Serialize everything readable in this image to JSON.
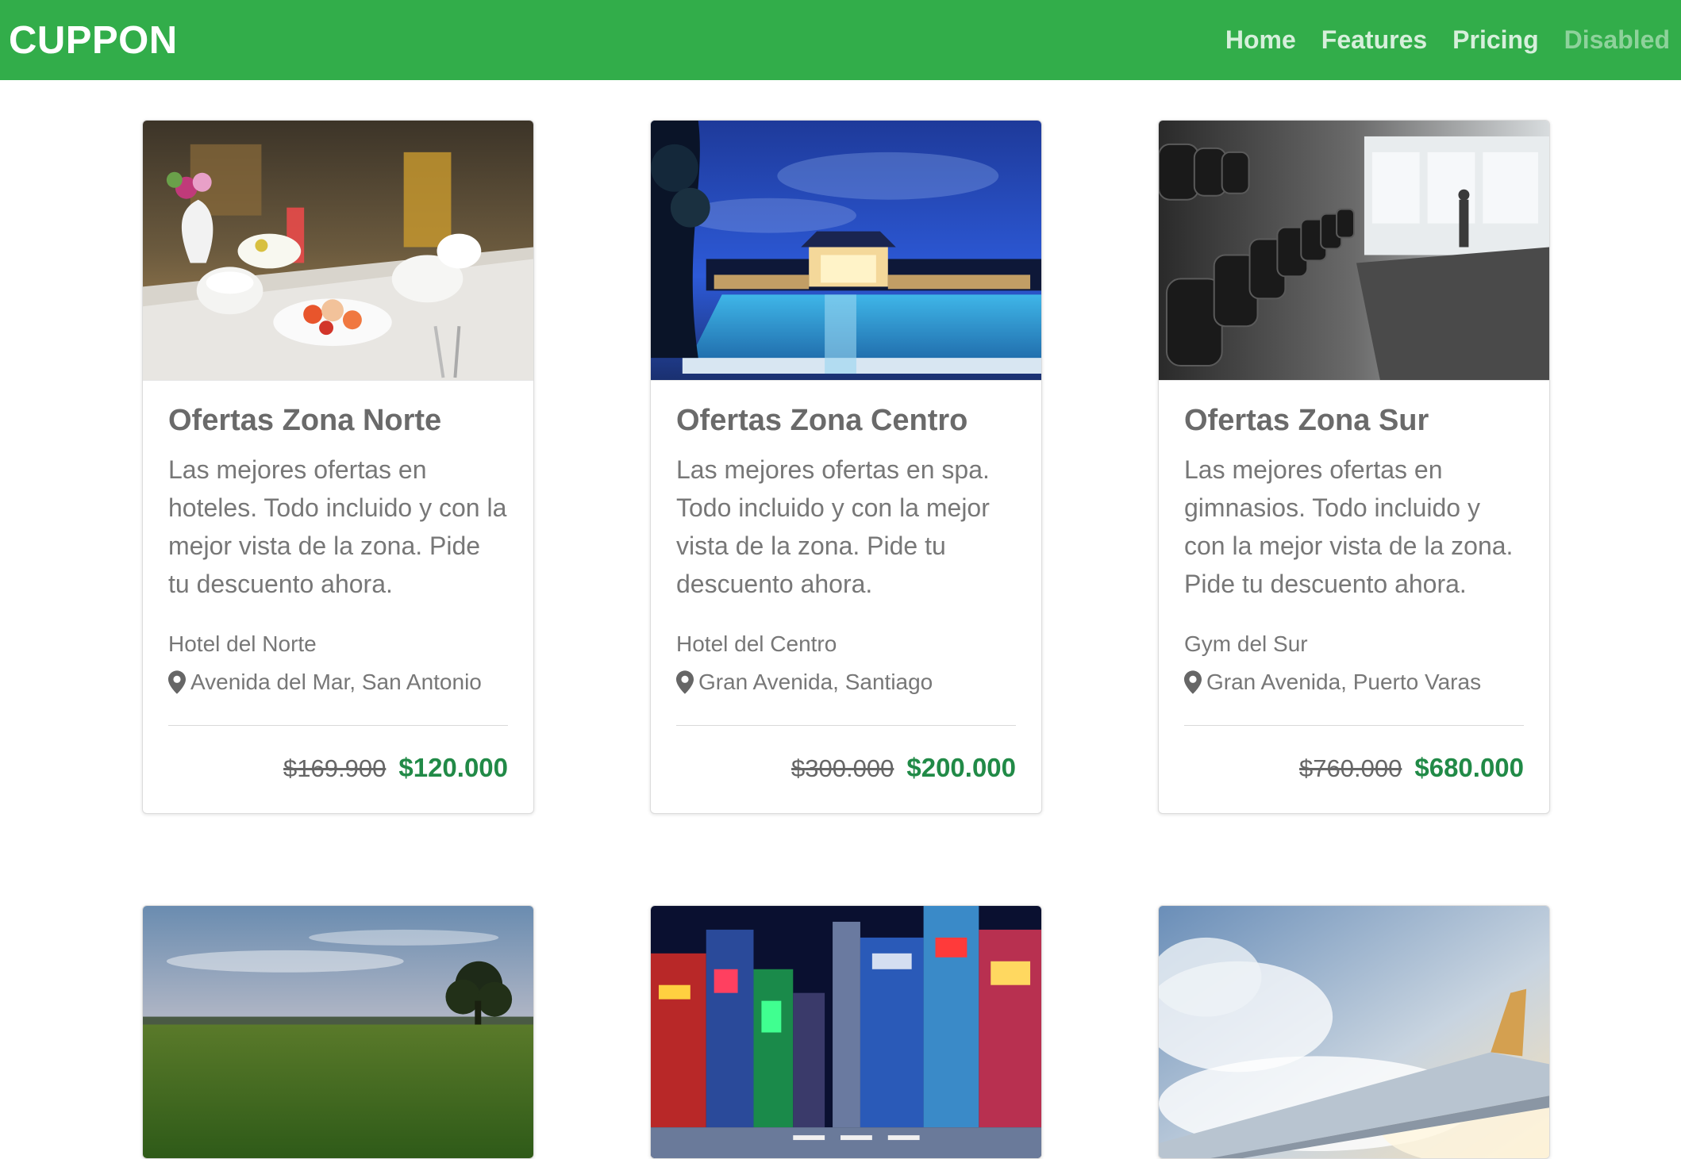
{
  "navbar": {
    "brand": "CUPPON",
    "links": [
      {
        "label": "Home",
        "disabled": false
      },
      {
        "label": "Features",
        "disabled": false
      },
      {
        "label": "Pricing",
        "disabled": false
      },
      {
        "label": "Disabled",
        "disabled": true
      }
    ]
  },
  "cards": [
    {
      "image": "breakfast-table-photo",
      "title": "Ofertas Zona Norte",
      "text": "Las mejores ofertas en hoteles. Todo incluido y con la mejor vista de la zona. Pide tu descuento ahora.",
      "provider": "Hotel del Norte",
      "address": "Avenida del Mar, San Antonio",
      "old_price": "$169.900",
      "new_price": "$120.000"
    },
    {
      "image": "resort-pool-night-photo",
      "title": "Ofertas Zona Centro",
      "text": "Las mejores ofertas en spa. Todo incluido y con la mejor vista de la zona. Pide tu descuento ahora.",
      "provider": "Hotel del Centro",
      "address": "Gran Avenida, Santiago",
      "old_price": "$300.000",
      "new_price": "$200.000"
    },
    {
      "image": "gym-dumbbells-photo",
      "title": "Ofertas Zona Sur",
      "text": "Las mejores ofertas en gimnasios. Todo incluido y con la mejor vista de la zona. Pide tu descuento ahora.",
      "provider": "Gym del Sur",
      "address": "Gran Avenida, Puerto Varas",
      "old_price": "$760.000",
      "new_price": "$680.000"
    },
    {
      "image": "green-field-sunset-photo"
    },
    {
      "image": "city-neon-street-photo"
    },
    {
      "image": "airplane-wing-clouds-photo"
    }
  ],
  "colors": {
    "navbar": "#32ad4a",
    "price": "#218a47"
  }
}
